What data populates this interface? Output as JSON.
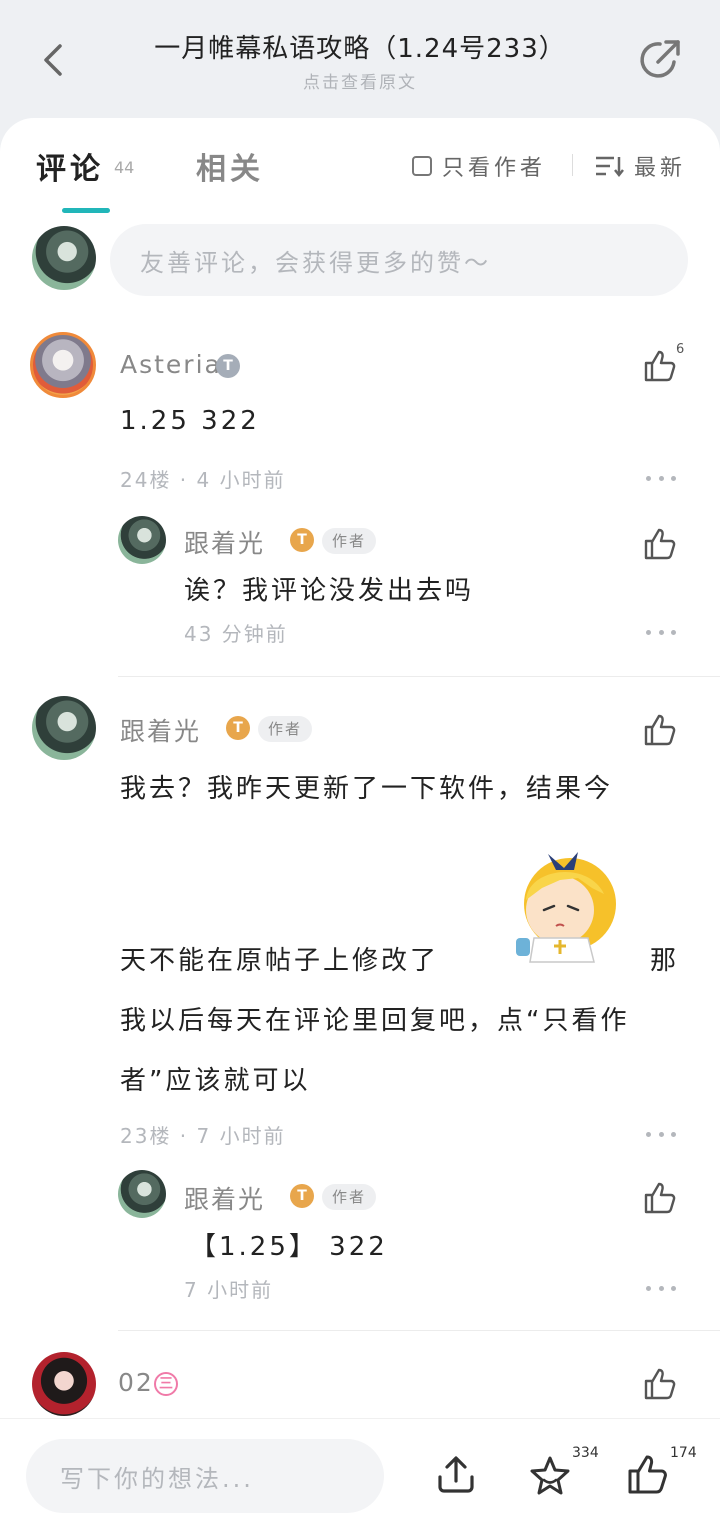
{
  "header": {
    "title": "一月帷幕私语攻略（1.24号233）",
    "subtitle": "点击查看原文"
  },
  "tabs": {
    "comments_label": "评论",
    "comments_count": "44",
    "related_label": "相关",
    "author_only_label": "只看作者",
    "sort_label": "最新"
  },
  "composer": {
    "placeholder": "友善评论，会获得更多的赞～"
  },
  "comments": [
    {
      "user": "Asteria",
      "content": "1.25 322",
      "meta": "24楼 · 4 小时前",
      "likes": "6",
      "reply": {
        "user": "跟着光",
        "tag": "作者",
        "content": "诶？我评论没发出去吗",
        "meta": "43 分钟前"
      }
    },
    {
      "user": "跟着光",
      "tag": "作者",
      "content_line1": "我去？我昨天更新了一下软件，结果今",
      "content_line2a": "天不能在原帖子上修改了",
      "content_line2b": "那",
      "content_line3": "我以后每天在评论里回复吧，点“只看作",
      "content_line4": "者”应该就可以",
      "meta": "23楼 · 7 小时前",
      "reply": {
        "user": "跟着光",
        "tag": "作者",
        "content": "【1.25】 322",
        "meta": "7 小时前"
      }
    },
    {
      "user": "02"
    }
  ],
  "bottom_bar": {
    "placeholder": "写下你的想法...",
    "favorite_count": "334",
    "like_count": "174"
  }
}
